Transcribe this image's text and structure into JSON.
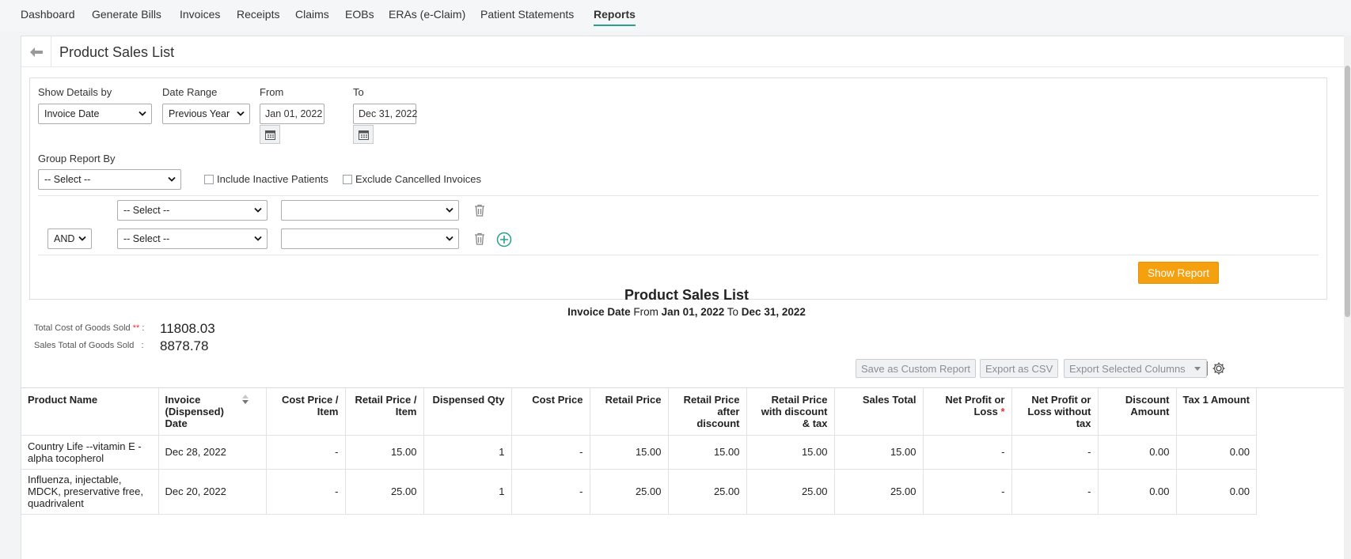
{
  "nav": {
    "items": [
      {
        "label": "Dashboard"
      },
      {
        "label": "Generate Bills"
      },
      {
        "label": "Invoices"
      },
      {
        "label": "Receipts"
      },
      {
        "label": "Claims"
      },
      {
        "label": "EOBs"
      },
      {
        "label": "ERAs (e-Claim)"
      },
      {
        "label": "Patient Statements"
      },
      {
        "label": "Reports"
      }
    ],
    "active": "Reports"
  },
  "header": {
    "title": "Product Sales List"
  },
  "filters": {
    "show_details_by": {
      "label": "Show Details by",
      "value": "Invoice Date"
    },
    "date_range": {
      "label": "Date Range",
      "value": "Previous Year"
    },
    "from": {
      "label": "From",
      "value": "Jan 01, 2022"
    },
    "to": {
      "label": "To",
      "value": "Dec 31, 2022"
    },
    "group_report_by": {
      "label": "Group Report By",
      "value": "-- Select --"
    },
    "include_inactive": {
      "label": "Include Inactive Patients",
      "checked": false
    },
    "exclude_cancelled": {
      "label": "Exclude Cancelled Invoices",
      "checked": false
    },
    "conditions": [
      {
        "field": "-- Select --",
        "value": ""
      },
      {
        "operator": "AND",
        "field": "-- Select --",
        "value": ""
      }
    ],
    "show_report_label": "Show Report"
  },
  "report": {
    "title": "Product Sales List",
    "sub_field": "Invoice Date",
    "sub_from_label": "From",
    "sub_from": "Jan 01, 2022",
    "sub_to_label": "To",
    "sub_to": "Dec 31, 2022"
  },
  "summary": {
    "cogs_label": "Total Cost of Goods Sold",
    "cogs_mark": "**",
    "cogs_value": "11808.03",
    "sales_label": "Sales Total of Goods Sold",
    "sales_value": "8878.78"
  },
  "actions": {
    "save_custom": "Save as Custom Report",
    "export_csv": "Export as CSV",
    "export_selected": "Export Selected Columns"
  },
  "table": {
    "columns": [
      "Product Name",
      "Invoice (Dispensed) Date",
      "Cost Price / Item",
      "Retail Price / Item",
      "Dispensed Qty",
      "Cost Price",
      "Retail Price",
      "Retail Price after discount",
      "Retail Price with discount & tax",
      "Sales Total",
      "Net Profit or Loss",
      "Net Profit or Loss without tax",
      "Discount Amount",
      "Tax 1 Amount"
    ],
    "net_profit_mark": "*",
    "rows": [
      [
        "Country Life --vitamin E - alpha tocopherol",
        "Dec 28, 2022",
        "-",
        "15.00",
        "1",
        "-",
        "15.00",
        "15.00",
        "15.00",
        "15.00",
        "-",
        "-",
        "0.00",
        "0.00"
      ],
      [
        "Influenza, injectable, MDCK, preservative free, quadrivalent",
        "Dec 20, 2022",
        "-",
        "25.00",
        "1",
        "-",
        "25.00",
        "25.00",
        "25.00",
        "25.00",
        "-",
        "-",
        "0.00",
        "0.00"
      ]
    ]
  },
  "colors": {
    "accent": "#2a9d8f",
    "primary_button": "#f5a00f"
  }
}
